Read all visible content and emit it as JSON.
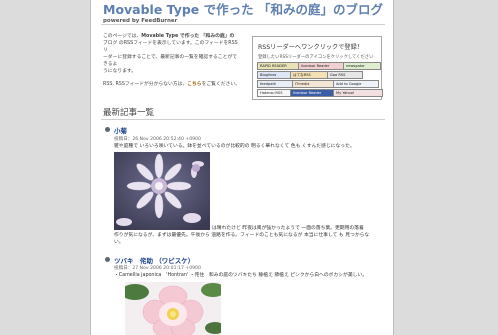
{
  "header": {
    "title": "Movable Type で作った 「和みの庭」のブログ",
    "subtitle": "powered by FeedBurner"
  },
  "intro": {
    "line1": "このページでは、",
    "line1_bold": "Movable Type で作った 「和みの庭」の",
    "line2": "ブログ のRSSフィードを表示しています。このフィードをRSSリ",
    "line3": "ーダーに登録することで、最新記事の一覧を確認することができるよ",
    "line4": "うになります。",
    "line5": "RSS, RSSフィードが分からない方は、",
    "line5_link": "こちら",
    "line5_end": "をご覧ください。"
  },
  "rss_box": {
    "title": "RSSリーダーへワンクリックで登録！",
    "subtitle": "登録したいRSSリーダーのアイコンをクリックしてください",
    "badges": [
      {
        "label": "RAPID READER",
        "color": "#e9e2b5"
      },
      {
        "label": "livedoor Reader",
        "color": "#f3d0d0"
      },
      {
        "label": "newsgator",
        "color": "#dfeecf"
      },
      {
        "label": "Bloglines",
        "color": "#dde6f5"
      },
      {
        "label": "はてなRSS",
        "color": "#f4e0b5"
      },
      {
        "label": "Goo RSS",
        "color": "#e6e6e6"
      },
      {
        "label": "feedpath",
        "color": "#e7eef7"
      },
      {
        "label": "ITmedia",
        "color": "#f4e7d6"
      },
      {
        "label": "Add to Google",
        "color": "#eef2fb"
      },
      {
        "label": "Hatena::RSS",
        "color": "#f7f7f7"
      },
      {
        "label": "livedoor Reader",
        "color": "#3a5da6"
      },
      {
        "label": "My Yahoo!",
        "color": "#f2e0e0"
      }
    ]
  },
  "section_title": "最新記事一覧",
  "posts": [
    {
      "title": "小菊",
      "meta": "投稿日：26 Nov 2006 20:52:40 +0900",
      "text1": "雑や庭種で いろいろ咲いている。鉢を並べているのが比較的の 明るく華れなくて 色も くすんだ感じになった。",
      "text2": "は晴れたけど 昨夜は風が強かったようで 一面の落ち葉。更期用の落着",
      "text3": "作りが気になるが、まずは最優先。午後から 道路を作る。フィードのことも気になるが 本当に仕事して も 見つからな",
      "text4": "い。"
    },
    {
      "title": "ツバキ　侘助 （ワビスケ）",
      "meta": "投稿日：27 Nov 2006 20:01:17 +0900",
      "text1": "・Camellia japonica　'Hontran' ・侘住　和みの庭のツバキたち 静植え 節植え ピンクから白へのボカシが美しい。"
    }
  ],
  "colors": {
    "title": "#5e7fb0",
    "post_title": "#1a3f8a",
    "link": "#a05a00"
  }
}
